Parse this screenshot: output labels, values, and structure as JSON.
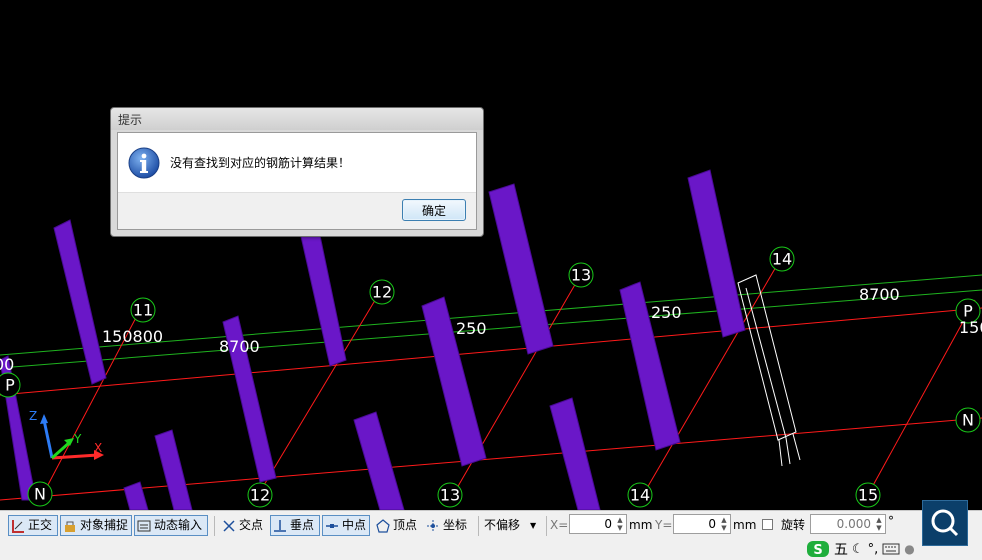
{
  "dialog": {
    "title": "提示",
    "message": "没有查找到对应的钢筋计算结果！",
    "ok_label": "确定"
  },
  "viewport": {
    "grid_numbers": [
      "11",
      "12",
      "13",
      "14",
      "12",
      "13",
      "14",
      "15"
    ],
    "row_letters": [
      "P",
      "N",
      "P",
      "N"
    ],
    "dimension_labels": [
      "150800",
      "8700",
      "8700",
      "250",
      "250",
      "8700",
      "150",
      "00"
    ],
    "axis_labels": [
      "Z",
      "Y",
      "X"
    ]
  },
  "toolbar": {
    "ortho": "正交",
    "snap": "对象捕捉",
    "dynamic_input": "动态输入",
    "intersection": "交点",
    "perpendicular": "垂点",
    "midpoint": "中点",
    "vertex": "顶点",
    "coordinate": "坐标",
    "offset_mode": "不偏移",
    "x_label": "X=",
    "x_value": "0",
    "x_unit": "mm",
    "y_label": "Y=",
    "y_value": "0",
    "y_unit": "mm",
    "rotate_label": "旋转",
    "rotate_value": "0.000",
    "rotate_unit": "°"
  },
  "ime": {
    "mode": "五"
  },
  "colors": {
    "column": "#6a17c8",
    "grid_red": "#ff1a1a",
    "grid_green": "#1fb31f",
    "axis_circle": "#19c819"
  }
}
